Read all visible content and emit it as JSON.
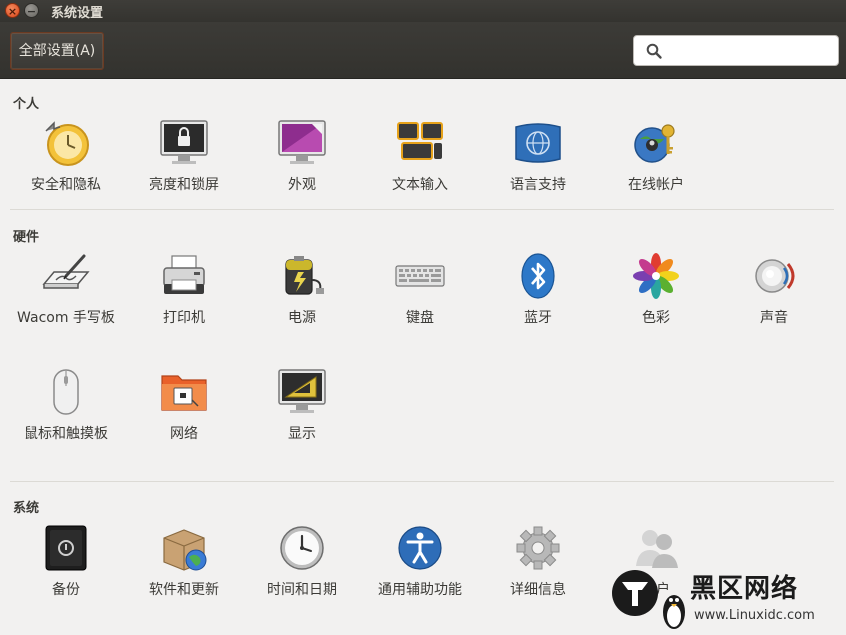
{
  "window": {
    "title": "系统设置"
  },
  "toolbar": {
    "all_settings_label": "全部设置(A)",
    "search_placeholder": ""
  },
  "sections": {
    "personal": {
      "title": "个人",
      "items": [
        "安全和隐私",
        "亮度和锁屏",
        "外观",
        "文本输入",
        "语言支持",
        "在线帐户"
      ]
    },
    "hardware": {
      "title": "硬件",
      "items": [
        "Wacom 手写板",
        "打印机",
        "电源",
        "键盘",
        "蓝牙",
        "色彩",
        "声音",
        "鼠标和触摸板",
        "网络",
        "显示"
      ]
    },
    "system": {
      "title": "系统",
      "items": [
        "备份",
        "软件和更新",
        "时间和日期",
        "通用辅助功能",
        "详细信息",
        "用户"
      ]
    }
  },
  "icons": {
    "personal": [
      "security-privacy-icon",
      "brightness-lock-icon",
      "appearance-icon",
      "text-entry-icon",
      "language-support-icon",
      "online-accounts-icon"
    ],
    "hardware": [
      "wacom-tablet-icon",
      "printer-icon",
      "power-icon",
      "keyboard-icon",
      "bluetooth-icon",
      "color-icon",
      "sound-icon",
      "mouse-touchpad-icon",
      "network-icon",
      "display-icon"
    ],
    "system": [
      "backup-icon",
      "software-updates-icon",
      "time-date-icon",
      "universal-access-icon",
      "details-icon",
      "user-accounts-icon"
    ]
  },
  "watermark": {
    "text": "黑区网络",
    "url": "www.Linuxidc.com"
  },
  "colors": {
    "titlebar": "#3c3b37",
    "close_button": "#df4a16",
    "background": "#f2f1f0",
    "text": "#3c3b37"
  }
}
